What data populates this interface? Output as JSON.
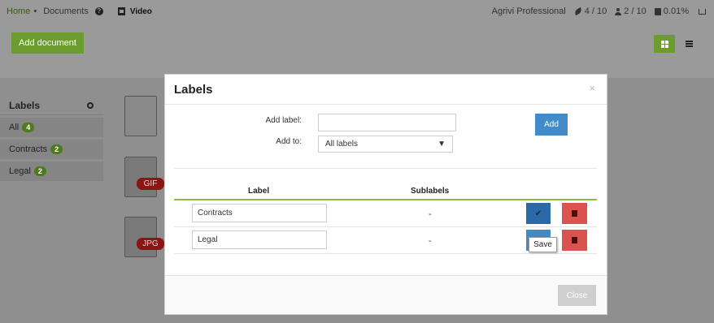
{
  "topbar": {
    "home": "Home",
    "separator": "•",
    "documents": "Documents",
    "video": "Video",
    "account": "Agrivi Professional",
    "fields": "4 / 10",
    "users": "2 / 10",
    "storage": "0.01%"
  },
  "toolbar": {
    "add_document": "Add document"
  },
  "sidebar": {
    "title": "Labels",
    "items": [
      {
        "label": "All",
        "count": "4"
      },
      {
        "label": "Contracts",
        "count": "2"
      },
      {
        "label": "Legal",
        "count": "2"
      }
    ]
  },
  "files": [
    {
      "tag": ""
    },
    {
      "tag": "GIF"
    },
    {
      "tag": "JPG"
    }
  ],
  "modal": {
    "title": "Labels",
    "close_symbol": "×",
    "add_label_text": "Add label:",
    "add_label_value": "",
    "add_to_text": "Add to:",
    "add_to_value": "All labels",
    "add_button": "Add",
    "col_label": "Label",
    "col_sublabels": "Sublabels",
    "rows": [
      {
        "label": "Contracts",
        "sublabels": "-"
      },
      {
        "label": "Legal",
        "sublabels": "-"
      }
    ],
    "tooltip": "Save",
    "close_button": "Close"
  }
}
